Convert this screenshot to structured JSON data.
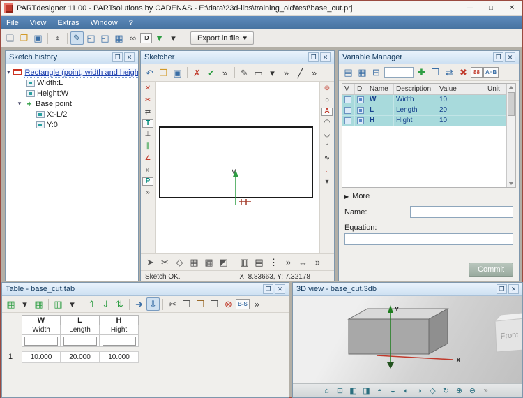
{
  "window": {
    "title": "PARTdesigner 11.00 - PARTsolutions by CADENAS - E:\\data\\23d-libs\\training_old\\test\\base_cut.prj",
    "buttons": {
      "minimize": "—",
      "maximize": "□",
      "close": "✕"
    }
  },
  "menubar": {
    "items": [
      "File",
      "View",
      "Extras",
      "Window",
      "?"
    ]
  },
  "glyphs": {
    "expander": "▾",
    "more_arrow": "▶",
    "float": "❐",
    "close": "✕",
    "dropdown": "▾",
    "plus": "+"
  },
  "colors": {
    "menubar": "#4e7cb2",
    "variable_row": "#a8dadc",
    "accent_blue": "#3a6ea5",
    "selection_blue": "#1c3fae"
  },
  "main_toolbar": {
    "export_label": "Export in file",
    "icons": [
      {
        "name": "new-file-icon",
        "glyph": "❏",
        "color": "#7d8ea0"
      },
      {
        "name": "open-file-icon",
        "glyph": "❐",
        "color": "#d29a2a"
      },
      {
        "name": "save-icon",
        "glyph": "▣",
        "color": "#3a6ea5"
      },
      {
        "name": "separator",
        "sep": true
      },
      {
        "name": "zoom-icon",
        "glyph": "⌖",
        "color": "#444444"
      },
      {
        "name": "separator",
        "sep": true
      },
      {
        "name": "sketcher-mode-icon",
        "glyph": "✎",
        "color": "#2e5f8a",
        "cls": "active"
      },
      {
        "name": "dimension-mode-icon",
        "glyph": "◰",
        "color": "#3a6ea5"
      },
      {
        "name": "variables-mode-icon",
        "glyph": "◱",
        "color": "#3a6ea5"
      },
      {
        "name": "table-mode-icon",
        "glyph": "▦",
        "color": "#3a6ea5"
      },
      {
        "name": "link-icon",
        "glyph": "∞",
        "color": "#555555"
      },
      {
        "name": "id-icon",
        "glyph": "ID",
        "cls": "txt",
        "color": "#222222"
      },
      {
        "name": "render-dropdown-icon",
        "glyph": "▼",
        "color": "#2f9e44"
      },
      {
        "name": "dropdown-arrow-icon",
        "glyph": "▾",
        "color": "#333333"
      }
    ]
  },
  "sketch_history": {
    "title": "Sketch history",
    "items": {
      "root": "Rectangle (point, width and height)",
      "width": "Width:L",
      "height": "Height:W",
      "base_point": "Base point",
      "x": "X:-L/2",
      "y": "Y:0"
    }
  },
  "sketcher": {
    "title": "Sketcher",
    "status": "Sketch OK.",
    "coords": "X: 8.83663, Y: 7.32178",
    "axis_label": "V",
    "toolbar_icons": [
      {
        "name": "undo-icon",
        "glyph": "↶",
        "color": "#3a6ea5"
      },
      {
        "name": "open-sketch-icon",
        "glyph": "❐",
        "color": "#d29a2a"
      },
      {
        "name": "save-sketch-icon",
        "glyph": "▣",
        "color": "#3a6ea5"
      },
      {
        "name": "separator",
        "sep": true
      },
      {
        "name": "discard-icon",
        "glyph": "✗",
        "color": "#c03a2b"
      },
      {
        "name": "accept-icon",
        "glyph": "✔",
        "color": "#2f9e44"
      },
      {
        "name": "overflow-icon",
        "glyph": "»",
        "color": "#444444"
      },
      {
        "name": "separator",
        "sep": true
      },
      {
        "name": "pen-icon",
        "glyph": "✎",
        "color": "#555555"
      },
      {
        "name": "rectangle-tool-icon",
        "glyph": "▭",
        "color": "#333333"
      },
      {
        "name": "rectangle-dropdown-icon",
        "glyph": "▾",
        "color": "#333333"
      },
      {
        "name": "overflow-icon-2",
        "glyph": "»",
        "color": "#444444"
      },
      {
        "name": "line-tool-icon",
        "glyph": "╱",
        "color": "#333333"
      },
      {
        "name": "overflow-icon-3",
        "glyph": "»",
        "color": "#444444"
      }
    ],
    "left_tool_icons": [
      {
        "name": "erase-point-icon",
        "glyph": "✕",
        "color": "#c03a2b"
      },
      {
        "name": "trim-icon",
        "glyph": "✂",
        "color": "#c03a2b"
      },
      {
        "name": "split-icon",
        "glyph": "⇄",
        "color": "#555555"
      },
      {
        "name": "tangent-icon",
        "glyph": "T",
        "cls": "txt",
        "color": "#00897b"
      },
      {
        "name": "perpendicular-icon",
        "glyph": "⊥",
        "color": "#555555"
      },
      {
        "name": "parallel-icon",
        "glyph": "∥",
        "color": "#2f9e44"
      },
      {
        "name": "angle-icon",
        "glyph": "∠",
        "color": "#c03a2b"
      },
      {
        "name": "overflow-icon",
        "glyph": "»",
        "color": "#444444"
      },
      {
        "name": "project-icon",
        "glyph": "P",
        "cls": "txt",
        "color": "#00897b"
      },
      {
        "name": "overflow-icon-2",
        "glyph": "»",
        "color": "#444444"
      }
    ],
    "right_tool_icons": [
      {
        "name": "target-icon",
        "glyph": "⊙",
        "color": "#c03a2b"
      },
      {
        "name": "circle-tool-icon",
        "glyph": "○",
        "color": "#333333"
      },
      {
        "name": "attribute-icon",
        "glyph": "A",
        "cls": "txt",
        "color": "#c03a2b"
      },
      {
        "name": "arc-tool-icon",
        "glyph": "◠",
        "color": "#333333"
      },
      {
        "name": "arc2-tool-icon",
        "glyph": "◡",
        "color": "#333333"
      },
      {
        "name": "arc3-tool-icon",
        "glyph": "◜",
        "color": "#333333"
      },
      {
        "name": "spline-tool-icon",
        "glyph": "∿",
        "color": "#333333"
      },
      {
        "name": "fillet-tool-icon",
        "glyph": "◟",
        "color": "#c03a2b"
      },
      {
        "name": "more-icon",
        "glyph": "▾",
        "color": "#444444"
      }
    ],
    "bottom_tool_icons": [
      {
        "name": "select-icon",
        "glyph": "➤",
        "color": "#555555"
      },
      {
        "name": "cut-icon",
        "glyph": "✂",
        "color": "#555555"
      },
      {
        "name": "mirror-icon",
        "glyph": "◇",
        "color": "#555555"
      },
      {
        "name": "array-icon",
        "glyph": "▦",
        "color": "#555555"
      },
      {
        "name": "pattern-icon",
        "glyph": "▩",
        "color": "#555555"
      },
      {
        "name": "shear-icon",
        "glyph": "◩",
        "color": "#555555"
      },
      {
        "name": "separator",
        "sep": true
      },
      {
        "name": "hatch-icon",
        "glyph": "▥",
        "color": "#333333"
      },
      {
        "name": "hatch2-icon",
        "glyph": "▤",
        "color": "#333333"
      },
      {
        "name": "dots-icon",
        "glyph": "⋮",
        "color": "#333333"
      },
      {
        "name": "overflow-icon",
        "glyph": "»",
        "color": "#444444"
      },
      {
        "name": "dimension-icon",
        "glyph": "↔",
        "color": "#555555"
      },
      {
        "name": "overflow-icon-2",
        "glyph": "»",
        "color": "#444444"
      }
    ]
  },
  "variable_manager": {
    "title": "Variable Manager",
    "filter_value": "",
    "columns": [
      "V",
      "D",
      "Name",
      "Description",
      "Value",
      "Unit"
    ],
    "rows": [
      {
        "name": "W",
        "description": "Width",
        "value": "10",
        "unit": ""
      },
      {
        "name": "L",
        "description": "Length",
        "value": "20",
        "unit": ""
      },
      {
        "name": "H",
        "description": "Hight",
        "value": "10",
        "unit": ""
      }
    ],
    "more_label": "More",
    "name_label": "Name:",
    "equation_label": "Equation:",
    "commit_label": "Commit",
    "toolbar_icons_left": [
      {
        "name": "list-view-icon",
        "glyph": "▤",
        "color": "#3a6ea5"
      },
      {
        "name": "grid-view-icon",
        "glyph": "▦",
        "color": "#3a6ea5"
      },
      {
        "name": "range-icon",
        "glyph": "⊟",
        "color": "#3a6ea5"
      }
    ],
    "toolbar_icons_right": [
      {
        "name": "add-variable-icon",
        "glyph": "✚",
        "color": "#2f9e44"
      },
      {
        "name": "copy-variable-icon",
        "glyph": "❐",
        "color": "#3a6ea5"
      },
      {
        "name": "swap-variable-icon",
        "glyph": "⇄",
        "color": "#3a6ea5"
      },
      {
        "name": "delete-variable-icon",
        "glyph": "✖",
        "color": "#c03a2b"
      },
      {
        "name": "number-format-icon",
        "glyph": "88",
        "cls": "txt",
        "color": "#c03a2b"
      },
      {
        "name": "rename-icon",
        "glyph": "A=B",
        "cls": "txt",
        "color": "#3a6ea5"
      }
    ]
  },
  "table_panel": {
    "title": "Table - base_cut.tab",
    "columns": [
      {
        "key": "W",
        "desc": "Width"
      },
      {
        "key": "L",
        "desc": "Length"
      },
      {
        "key": "H",
        "desc": "Hight"
      }
    ],
    "row_number": "1",
    "values": [
      "10.000",
      "20.000",
      "10.000"
    ],
    "toolbar_icons": [
      {
        "name": "add-table-icon",
        "glyph": "▦",
        "color": "#2f9e44"
      },
      {
        "name": "table-dropdown-icon",
        "glyph": "▾",
        "color": "#333333"
      },
      {
        "name": "edit-table-icon",
        "glyph": "▦",
        "color": "#2f9e44"
      },
      {
        "name": "separator",
        "sep": true
      },
      {
        "name": "col-insert-icon",
        "glyph": "▥",
        "color": "#2f9e44"
      },
      {
        "name": "col-dropdown-icon",
        "glyph": "▾",
        "color": "#333333"
      },
      {
        "name": "separator",
        "sep": true
      },
      {
        "name": "row-up-icon",
        "glyph": "⇑",
        "color": "#2f9e44"
      },
      {
        "name": "row-down-icon",
        "glyph": "⇓",
        "color": "#2f9e44"
      },
      {
        "name": "row-swap-icon",
        "glyph": "⇅",
        "color": "#2f9e44"
      },
      {
        "name": "separator",
        "sep": true
      },
      {
        "name": "apply-icon",
        "glyph": "➜",
        "color": "#3a6ea5"
      },
      {
        "name": "insert-row-icon",
        "glyph": "⇩",
        "cls": "active",
        "color": "#3a6ea5"
      },
      {
        "name": "separator",
        "sep": true
      },
      {
        "name": "cut-icon",
        "glyph": "✂",
        "color": "#555555"
      },
      {
        "name": "copy-icon",
        "glyph": "❐",
        "color": "#555555"
      },
      {
        "name": "paste-icon",
        "glyph": "❒",
        "color": "#9a6a2a"
      },
      {
        "name": "paste-special-icon",
        "glyph": "❒",
        "color": "#555555"
      },
      {
        "name": "delete-row-icon",
        "glyph": "⊗",
        "color": "#c03a2b"
      },
      {
        "name": "bs-icon",
        "glyph": "B-S",
        "cls": "txt",
        "color": "#3a6ea5"
      },
      {
        "name": "overflow-icon",
        "glyph": "»",
        "color": "#444444"
      }
    ]
  },
  "view3d": {
    "title": "3D view - base_cut.3db",
    "cube_label": "Front",
    "x_label": "X",
    "y_label": "Y",
    "toolbar_icons": [
      {
        "name": "view-home-icon",
        "glyph": "⌂",
        "color": "#2a6f7f"
      },
      {
        "name": "fit-view-icon",
        "glyph": "⊡",
        "color": "#2a6f7f"
      },
      {
        "name": "front-view-icon",
        "glyph": "◧",
        "color": "#2a6f7f"
      },
      {
        "name": "back-view-icon",
        "glyph": "◨",
        "color": "#2a6f7f"
      },
      {
        "name": "top-view-icon",
        "glyph": "◓",
        "color": "#2a6f7f"
      },
      {
        "name": "bottom-view-icon",
        "glyph": "◒",
        "color": "#2a6f7f"
      },
      {
        "name": "left-view-icon",
        "glyph": "◐",
        "color": "#2a6f7f"
      },
      {
        "name": "right-view-icon",
        "glyph": "◑",
        "color": "#2a6f7f"
      },
      {
        "name": "iso-view-icon",
        "glyph": "◇",
        "color": "#2a6f7f"
      },
      {
        "name": "rotate-view-icon",
        "glyph": "↻",
        "color": "#2a6f7f"
      },
      {
        "name": "zoom-in-icon",
        "glyph": "⊕",
        "color": "#2a6f7f"
      },
      {
        "name": "zoom-out-icon",
        "glyph": "⊖",
        "color": "#2a6f7f"
      },
      {
        "name": "overflow-icon",
        "glyph": "»",
        "color": "#444444"
      }
    ]
  }
}
